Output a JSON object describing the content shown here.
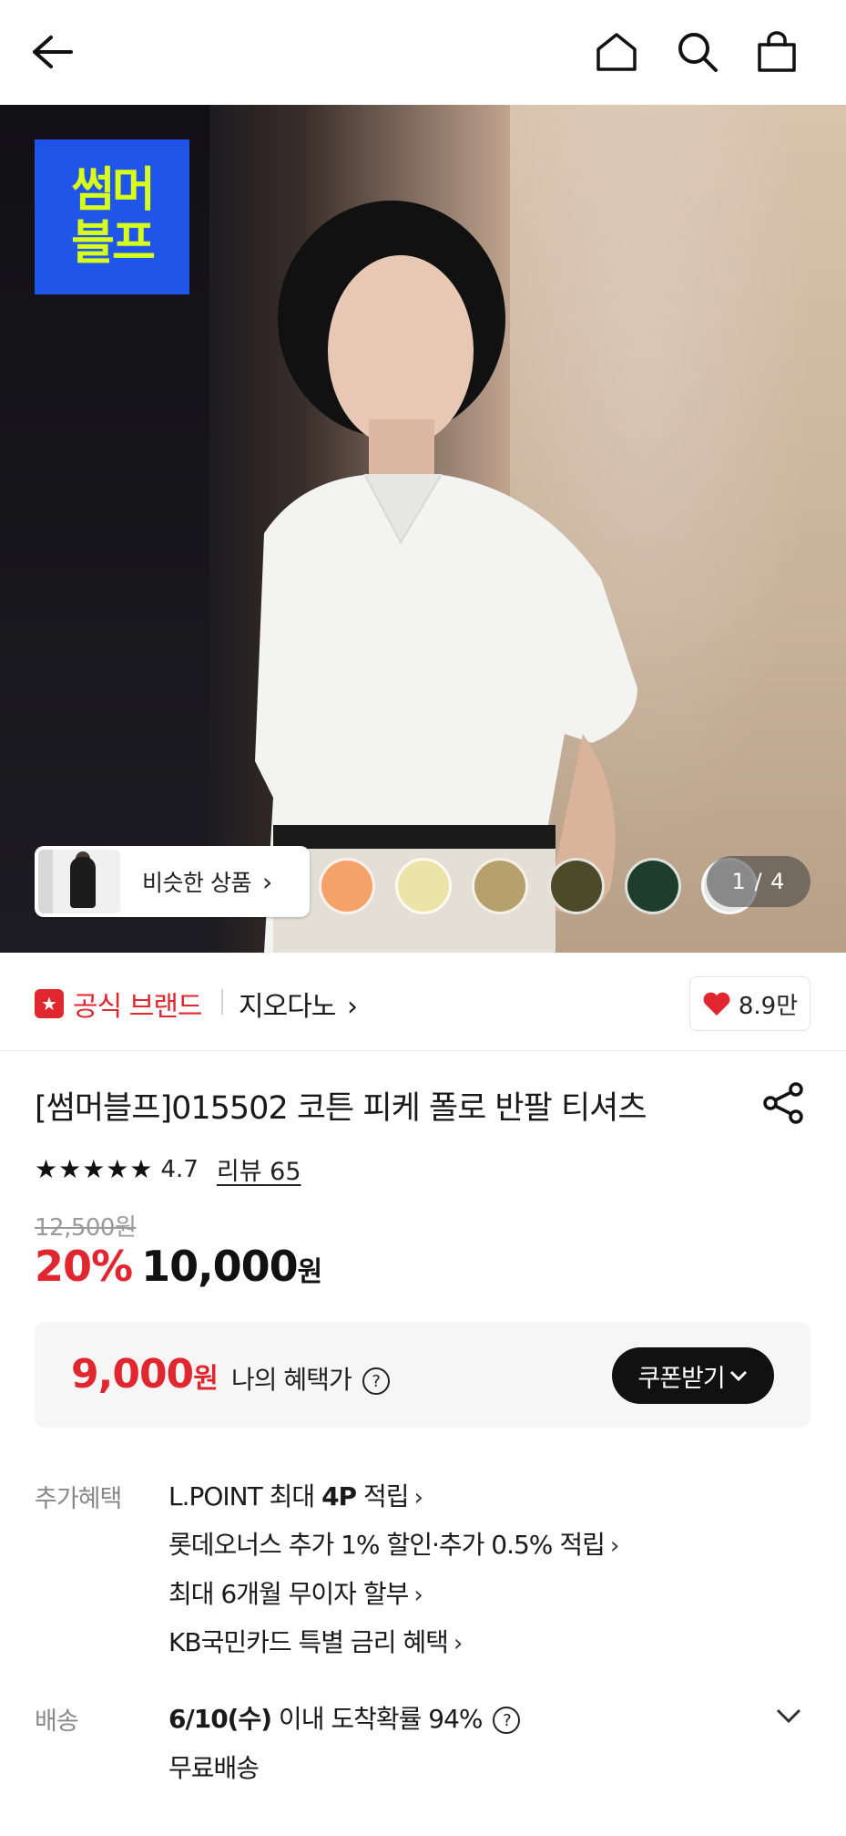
{
  "nav": {
    "back_icon": "arrow-left-icon",
    "home_icon": "home-icon",
    "search_icon": "search-icon",
    "cart_icon": "shopping-bag-icon"
  },
  "hero": {
    "brand_logo_line1": "썸머",
    "brand_logo_line2": "블프",
    "similar_label": "비슷한 상품",
    "similar_chevron": "›",
    "counter": "1 / 4",
    "swatch_colors": [
      "#f5a26a",
      "#ece3a6",
      "#b6a06c",
      "#4d4a2a",
      "#1f3d2b",
      "#e6e6e6"
    ]
  },
  "brand": {
    "official_label": "공식 브랜드",
    "name": "지오다노",
    "name_chevron": "›",
    "likes": "8.9만"
  },
  "product": {
    "title": "[썸머블프]015502 코튼 피케 폴로 반팔 티셔츠",
    "stars": "★★★★★",
    "rating": "4.7",
    "reviews": "리뷰 65",
    "original_price": "12,500원",
    "discount": "20%",
    "price": "10,000",
    "price_unit": "원"
  },
  "benefit": {
    "price": "9,000",
    "price_unit": "원",
    "label": "나의 혜택가",
    "help": "?",
    "coupon_button": "쿠폰받기"
  },
  "extra": {
    "label": "추가혜택",
    "items": [
      {
        "prefix": "L.POINT 최대 ",
        "bold": "4P",
        "suffix": " 적립"
      },
      {
        "prefix": "롯데오너스 추가 1% 할인·추가 0.5% 적립",
        "bold": "",
        "suffix": ""
      },
      {
        "prefix": "최대 6개월 무이자 할부",
        "bold": "",
        "suffix": ""
      },
      {
        "prefix": "KB국민카드 특별 금리 혜택",
        "bold": "",
        "suffix": ""
      }
    ]
  },
  "shipping": {
    "label": "배송",
    "date": "6/10(수)",
    "arrival_text": " 이내 도착확률 94%",
    "free": "무료배송"
  },
  "colors": {
    "accent_red": "#e0262f",
    "brand_blue": "#1f55e8",
    "brand_yellow": "#d8ff1a"
  }
}
